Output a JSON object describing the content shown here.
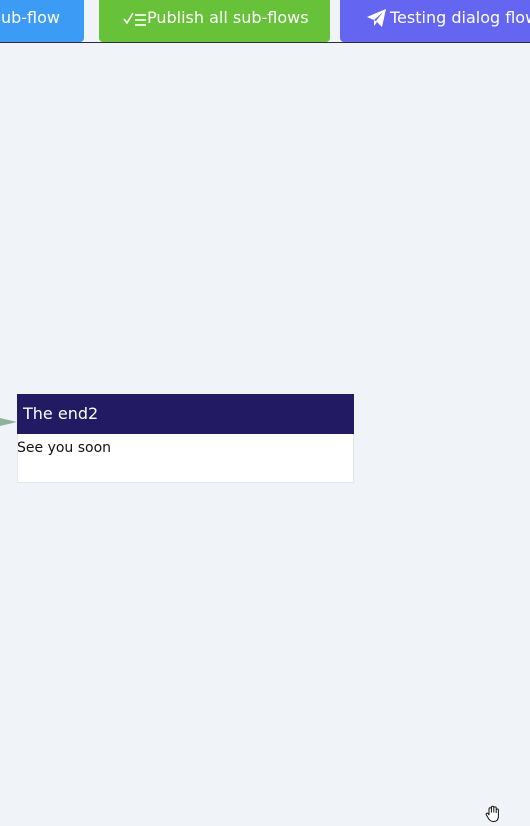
{
  "toolbar": {
    "sub_flow_label": "sub-flow",
    "publish_label": "Publish all sub-flows",
    "testing_label": "Testing dialog flow",
    "colors": {
      "sub_flow": "#3b9bf5",
      "publish": "#67c23a",
      "testing": "#6466f1"
    }
  },
  "canvas": {
    "node": {
      "title": "The end2",
      "text": "See you soon",
      "header_color": "#221a63"
    },
    "edge_color": "#8fb39a"
  },
  "icons": {
    "publish": "checklist-icon",
    "testing": "paper-plane-icon",
    "cursor": "hand-grab-icon"
  }
}
